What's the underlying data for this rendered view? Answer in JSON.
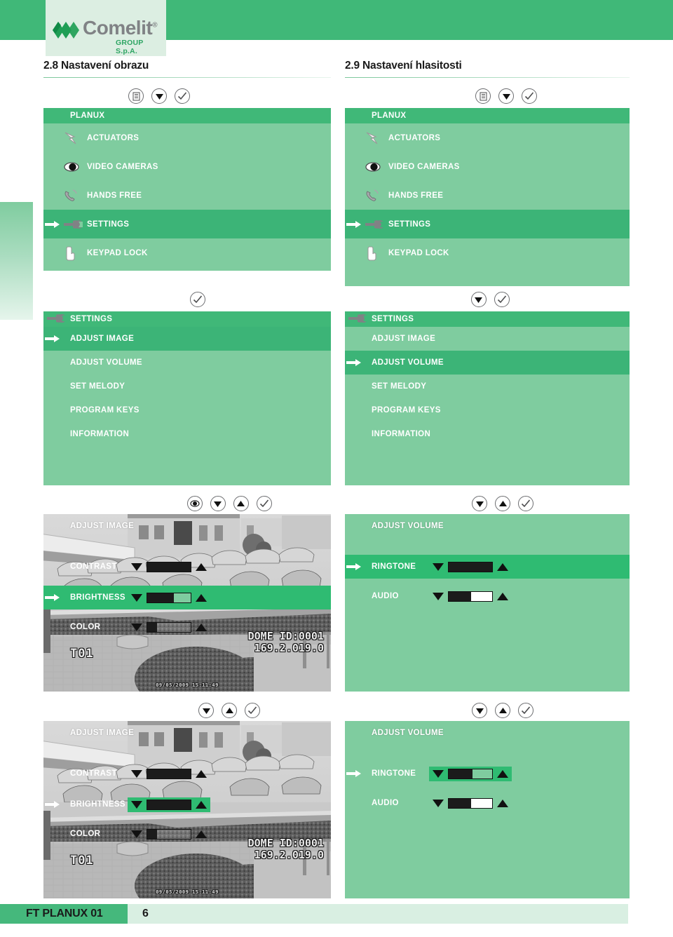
{
  "brand": {
    "name": "Comelit",
    "registered": "®",
    "subtitle": "GROUP S.p.A."
  },
  "colors": {
    "accent": "#40b878",
    "panel_body": "#7fcc9f",
    "panel_selected": "#3cb477",
    "slider_selected": "#2fbb72",
    "logo_text": "#808285",
    "logo_green": "#2ea563",
    "footer_tab": "#45b87c",
    "footer_strip": "#d9efe2"
  },
  "sections": {
    "left": {
      "number_title": "2.8 Nastavení obrazu"
    },
    "right": {
      "number_title": "2.9 Nastavení hlasitosti"
    }
  },
  "icon_rows": {
    "main_menu": [
      "list-icon",
      "down-triangle-icon",
      "check-icon"
    ],
    "settings_left": [
      "check-icon"
    ],
    "settings_right": [
      "down-triangle-icon",
      "check-icon"
    ],
    "adjust_image_top": [
      "record-dot-icon",
      "down-triangle-icon",
      "up-triangle-icon",
      "check-icon"
    ],
    "adjust_volume_top": [
      "down-triangle-icon",
      "up-triangle-icon",
      "check-icon"
    ],
    "adjust_image_bottom": [
      "down-triangle-icon",
      "up-triangle-icon",
      "check-icon"
    ],
    "adjust_volume_bottom": [
      "down-triangle-icon",
      "up-triangle-icon",
      "check-icon"
    ]
  },
  "main_menu": {
    "title": "PLANUX",
    "items": [
      {
        "label": "ACTUATORS",
        "icon": "lightning-bolt-icon",
        "selected": false
      },
      {
        "label": "VIDEO CAMERAS",
        "icon": "eye-icon",
        "selected": false
      },
      {
        "label": "HANDS FREE",
        "icon": "handset-icon",
        "selected": false
      },
      {
        "label": "SETTINGS",
        "icon": "wrench-icon",
        "selected": true
      },
      {
        "label": "KEYPAD LOCK",
        "icon": "pointing-hand-icon",
        "selected": false
      }
    ]
  },
  "settings_menu": {
    "title": "SETTINGS",
    "title_icon": "wrench-icon",
    "items": [
      "ADJUST IMAGE",
      "ADJUST VOLUME",
      "SET MELODY",
      "PROGRAM KEYS",
      "INFORMATION"
    ],
    "selected_left": "ADJUST IMAGE",
    "selected_right": "ADJUST VOLUME"
  },
  "adjust_image": {
    "title": "ADJUST IMAGE",
    "rows": [
      {
        "label": "CONTRAST",
        "value_pct": 100,
        "selected": false
      },
      {
        "label": "BRIGHTNESS",
        "value_pct": 62,
        "selected": true
      },
      {
        "label": "COLOR",
        "value_pct": 22,
        "selected": false
      }
    ],
    "rows_bottom": [
      {
        "label": "CONTRAST",
        "value_pct": 100,
        "selected": false
      },
      {
        "label": "BRIGHTNESS",
        "value_pct": 100,
        "selected": true
      },
      {
        "label": "COLOR",
        "value_pct": 22,
        "selected": false
      }
    ],
    "video": {
      "camera_label": "T01",
      "dome_line1": "DOME ID:0001",
      "dome_line2": "169.2.019.0",
      "timestamp": "09/05/2009 15:11:49"
    }
  },
  "adjust_volume": {
    "title": "ADJUST VOLUME",
    "rows_top": [
      {
        "label": "RINGTONE",
        "value_pct": 100,
        "selected": true
      },
      {
        "label": "AUDIO",
        "value_pct": 52,
        "selected": false
      }
    ],
    "rows_bottom": [
      {
        "label": "RINGTONE",
        "value_pct": 55,
        "selected": true
      },
      {
        "label": "AUDIO",
        "value_pct": 52,
        "selected": false
      }
    ]
  },
  "footer": {
    "title": "FT PLANUX 01",
    "page": "6"
  }
}
